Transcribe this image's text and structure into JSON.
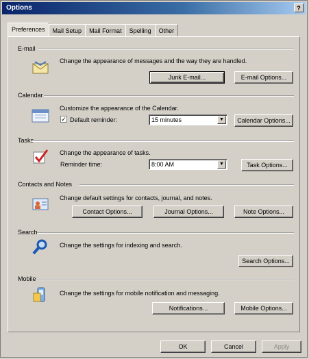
{
  "window": {
    "title": "Options",
    "help": "?"
  },
  "tabs": [
    "Preferences",
    "Mail Setup",
    "Mail Format",
    "Spelling",
    "Other"
  ],
  "email": {
    "label": "E-mail",
    "description": "Change the appearance of messages and the way they are handled.",
    "junk_button": "Junk E-mail...",
    "options_button": "E-mail Options..."
  },
  "calendar": {
    "label": "Calendar",
    "description": "Customize the appearance of the Calendar.",
    "reminder_checkbox": "Default reminder:",
    "reminder_checked": "✓",
    "reminder_value": "15 minutes",
    "options_button": "Calendar Options..."
  },
  "tasks": {
    "label": "Tasks",
    "description": "Change the appearance of tasks.",
    "reminder_label": "Reminder time:",
    "reminder_value": "8:00 AM",
    "options_button": "Task Options..."
  },
  "contacts": {
    "label": "Contacts and Notes",
    "description": "Change default settings for contacts, journal, and notes.",
    "contact_button": "Contact Options...",
    "journal_button": "Journal Options...",
    "note_button": "Note Options..."
  },
  "search": {
    "label": "Search",
    "description": "Change the settings for indexing and search.",
    "options_button": "Search Options..."
  },
  "mobile": {
    "label": "Mobile",
    "description": "Change the settings for mobile notification and messaging.",
    "notifications_button": "Notifications...",
    "options_button": "Mobile Options..."
  },
  "footer": {
    "ok": "OK",
    "cancel": "Cancel",
    "apply": "Apply"
  },
  "icons": {
    "email": "envelope-icon",
    "calendar": "calendar-icon",
    "tasks": "checkmark-icon",
    "contacts": "contact-card-icon",
    "search": "magnifier-icon",
    "mobile": "mobile-phone-icon"
  }
}
